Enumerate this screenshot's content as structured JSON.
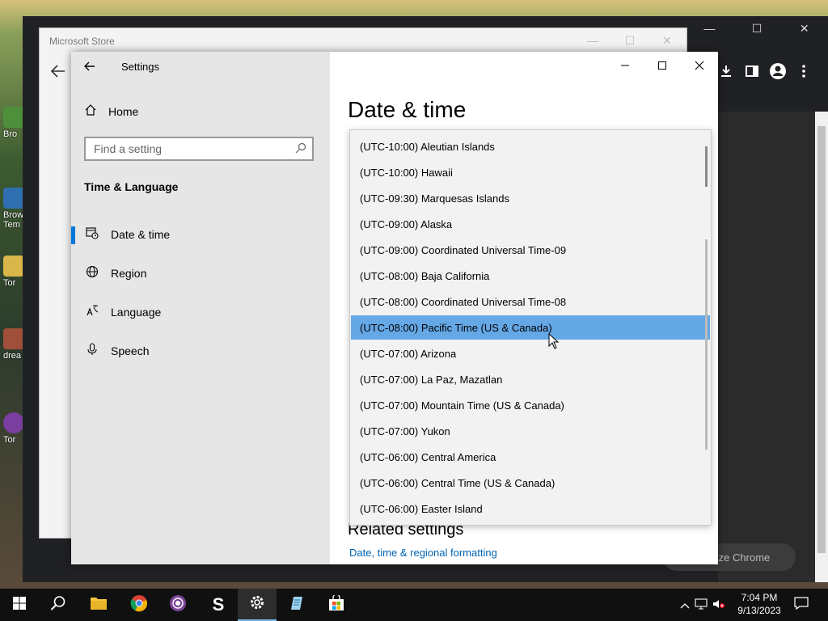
{
  "desktop": {
    "icons": [
      {
        "label": "Bro",
        "color": "#4d8f3a"
      },
      {
        "label": "Brow Tem",
        "color": "#2f6fb0"
      },
      {
        "label": "Tor",
        "color": "#d9b64a"
      },
      {
        "label": "drea",
        "color": "#a0503a"
      },
      {
        "label": "Tor",
        "color": "#7a3fa0"
      }
    ]
  },
  "chrome": {
    "customize_label": "omize Chrome",
    "controls": [
      "—",
      "☐",
      "✕"
    ]
  },
  "store": {
    "title": "Microsoft Store"
  },
  "settings": {
    "app_title": "Settings",
    "home_label": "Home",
    "search_placeholder": "Find a setting",
    "section_title": "Time & Language",
    "nav_items": [
      {
        "label": "Date & time",
        "icon": "calendar-clock-icon",
        "selected": true
      },
      {
        "label": "Region",
        "icon": "globe-icon",
        "selected": false
      },
      {
        "label": "Language",
        "icon": "language-icon",
        "selected": false
      },
      {
        "label": "Speech",
        "icon": "microphone-icon",
        "selected": false
      }
    ],
    "page_title": "Date & time",
    "related_title": "Related settings",
    "related_link": "Date, time & regional formatting"
  },
  "timezones": {
    "selected_index": 7,
    "items": [
      "(UTC-10:00) Aleutian Islands",
      "(UTC-10:00) Hawaii",
      "(UTC-09:30) Marquesas Islands",
      "(UTC-09:00) Alaska",
      "(UTC-09:00) Coordinated Universal Time-09",
      "(UTC-08:00) Baja California",
      "(UTC-08:00) Coordinated Universal Time-08",
      "(UTC-08:00) Pacific Time (US & Canada)",
      "(UTC-07:00) Arizona",
      "(UTC-07:00) La Paz, Mazatlan",
      "(UTC-07:00) Mountain Time (US & Canada)",
      "(UTC-07:00) Yukon",
      "(UTC-06:00) Central America",
      "(UTC-06:00) Central Time (US & Canada)",
      "(UTC-06:00) Easter Island"
    ]
  },
  "taskbar": {
    "time": "7:04 PM",
    "date": "9/13/2023",
    "apps": [
      "start-icon",
      "search-icon",
      "file-explorer-icon",
      "chrome-icon",
      "tor-icon",
      "s-app-icon",
      "settings-icon",
      "notepad-icon",
      "store-icon"
    ]
  },
  "colors": {
    "accent": "#0078d7",
    "selection": "#65a8e6",
    "link": "#0063b1"
  }
}
